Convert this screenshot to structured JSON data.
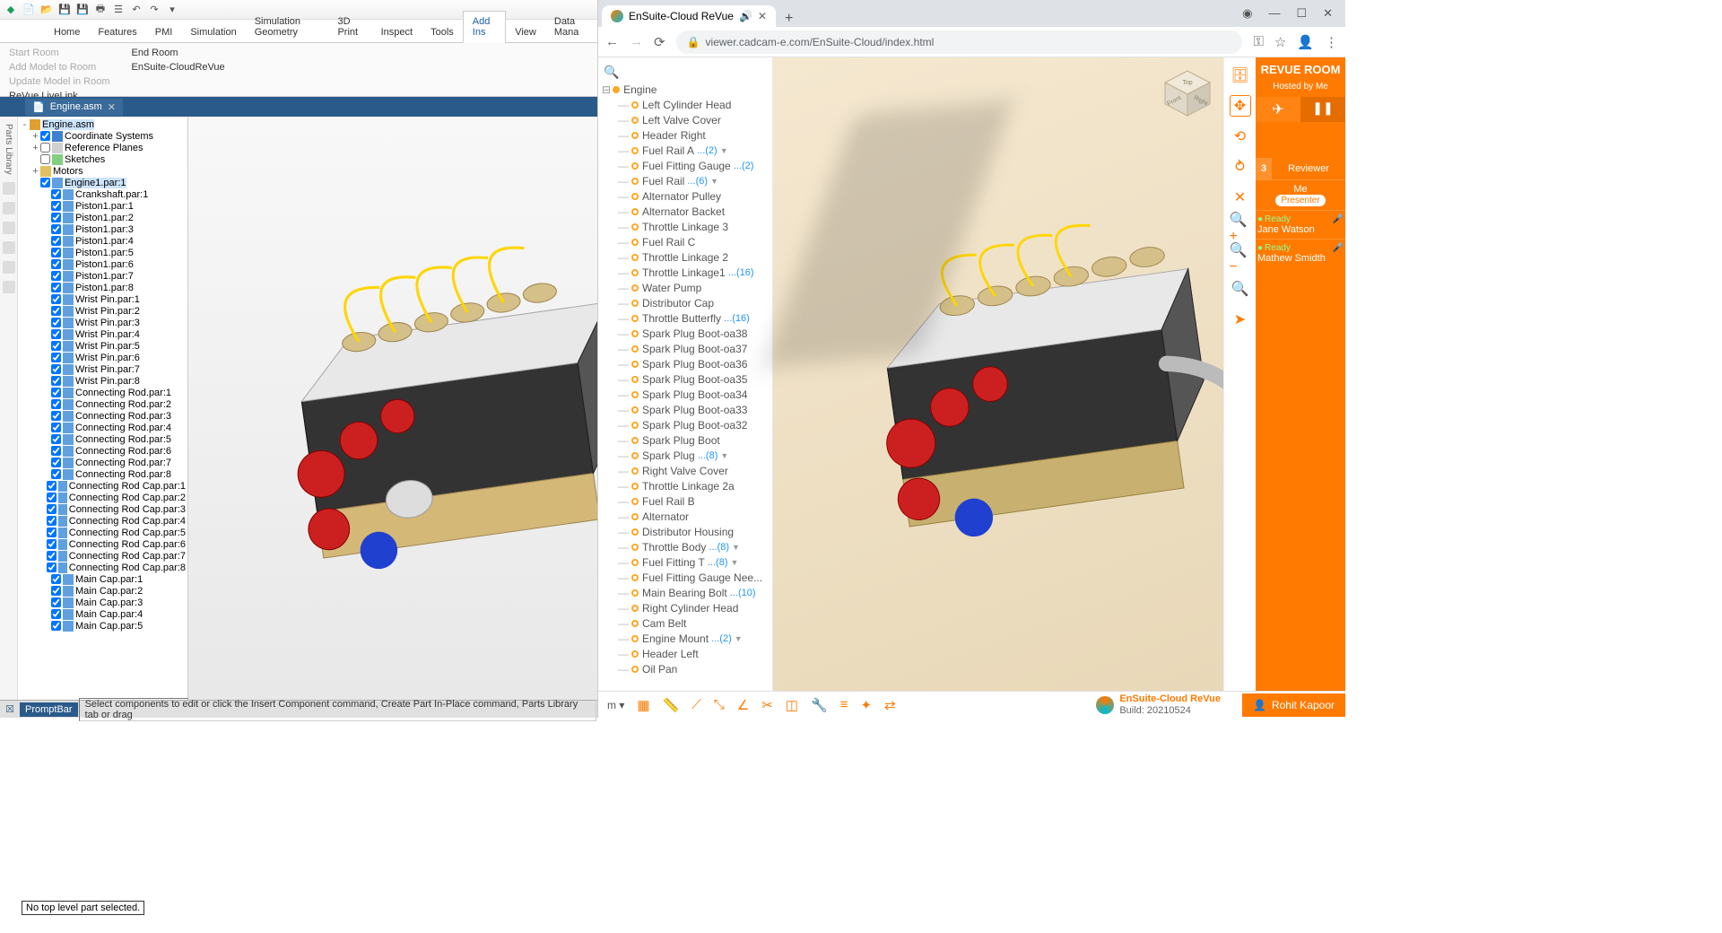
{
  "left": {
    "ribbon_tabs": [
      "Home",
      "Features",
      "PMI",
      "Simulation",
      "Simulation Geometry",
      "3D Print",
      "Inspect",
      "Tools",
      "Add Ins",
      "View",
      "Data Mana"
    ],
    "active_tab": "Add Ins",
    "ribbon_groups": {
      "col1": [
        {
          "label": "Start Room",
          "disabled": true
        },
        {
          "label": "Add Model to Room",
          "disabled": true
        },
        {
          "label": "Update Model in Room",
          "disabled": true
        },
        {
          "label": "ReVue LiveLink",
          "disabled": false
        }
      ],
      "col2": [
        {
          "label": "End Room",
          "disabled": false
        },
        {
          "label": "EnSuite-CloudReVue",
          "disabled": false
        }
      ]
    },
    "doc_tab": "Engine.asm",
    "parts_library_label": "Parts Library",
    "tree": [
      {
        "d": 0,
        "exp": "-",
        "ico": "asm",
        "txt": "Engine.asm",
        "sel": true
      },
      {
        "d": 1,
        "exp": "+",
        "chk": true,
        "ico": "coord",
        "txt": "Coordinate Systems"
      },
      {
        "d": 1,
        "exp": "+",
        "chk": false,
        "ico": "plane",
        "txt": "Reference Planes"
      },
      {
        "d": 1,
        "exp": "",
        "chk": false,
        "ico": "sketch",
        "txt": "Sketches"
      },
      {
        "d": 1,
        "exp": "+",
        "ico": "folder",
        "txt": "Motors"
      },
      {
        "d": 1,
        "exp": "",
        "chk": true,
        "ico": "part",
        "txt": "Engine1.par:1",
        "sel": true
      },
      {
        "d": 2,
        "exp": "",
        "chk": true,
        "ico": "part",
        "txt": "Crankshaft.par:1"
      },
      {
        "d": 2,
        "exp": "",
        "chk": true,
        "ico": "part",
        "txt": "Piston1.par:1"
      },
      {
        "d": 2,
        "exp": "",
        "chk": true,
        "ico": "part",
        "txt": "Piston1.par:2"
      },
      {
        "d": 2,
        "exp": "",
        "chk": true,
        "ico": "part",
        "txt": "Piston1.par:3"
      },
      {
        "d": 2,
        "exp": "",
        "chk": true,
        "ico": "part",
        "txt": "Piston1.par:4"
      },
      {
        "d": 2,
        "exp": "",
        "chk": true,
        "ico": "part",
        "txt": "Piston1.par:5"
      },
      {
        "d": 2,
        "exp": "",
        "chk": true,
        "ico": "part",
        "txt": "Piston1.par:6"
      },
      {
        "d": 2,
        "exp": "",
        "chk": true,
        "ico": "part",
        "txt": "Piston1.par:7"
      },
      {
        "d": 2,
        "exp": "",
        "chk": true,
        "ico": "part",
        "txt": "Piston1.par:8"
      },
      {
        "d": 2,
        "exp": "",
        "chk": true,
        "ico": "part",
        "txt": "Wrist Pin.par:1"
      },
      {
        "d": 2,
        "exp": "",
        "chk": true,
        "ico": "part",
        "txt": "Wrist Pin.par:2"
      },
      {
        "d": 2,
        "exp": "",
        "chk": true,
        "ico": "part",
        "txt": "Wrist Pin.par:3"
      },
      {
        "d": 2,
        "exp": "",
        "chk": true,
        "ico": "part",
        "txt": "Wrist Pin.par:4"
      },
      {
        "d": 2,
        "exp": "",
        "chk": true,
        "ico": "part",
        "txt": "Wrist Pin.par:5"
      },
      {
        "d": 2,
        "exp": "",
        "chk": true,
        "ico": "part",
        "txt": "Wrist Pin.par:6"
      },
      {
        "d": 2,
        "exp": "",
        "chk": true,
        "ico": "part",
        "txt": "Wrist Pin.par:7"
      },
      {
        "d": 2,
        "exp": "",
        "chk": true,
        "ico": "part",
        "txt": "Wrist Pin.par:8"
      },
      {
        "d": 2,
        "exp": "",
        "chk": true,
        "ico": "part",
        "txt": "Connecting Rod.par:1"
      },
      {
        "d": 2,
        "exp": "",
        "chk": true,
        "ico": "part",
        "txt": "Connecting Rod.par:2"
      },
      {
        "d": 2,
        "exp": "",
        "chk": true,
        "ico": "part",
        "txt": "Connecting Rod.par:3"
      },
      {
        "d": 2,
        "exp": "",
        "chk": true,
        "ico": "part",
        "txt": "Connecting Rod.par:4"
      },
      {
        "d": 2,
        "exp": "",
        "chk": true,
        "ico": "part",
        "txt": "Connecting Rod.par:5"
      },
      {
        "d": 2,
        "exp": "",
        "chk": true,
        "ico": "part",
        "txt": "Connecting Rod.par:6"
      },
      {
        "d": 2,
        "exp": "",
        "chk": true,
        "ico": "part",
        "txt": "Connecting Rod.par:7"
      },
      {
        "d": 2,
        "exp": "",
        "chk": true,
        "ico": "part",
        "txt": "Connecting Rod.par:8"
      },
      {
        "d": 2,
        "exp": "",
        "chk": true,
        "ico": "part",
        "txt": "Connecting Rod Cap.par:1"
      },
      {
        "d": 2,
        "exp": "",
        "chk": true,
        "ico": "part",
        "txt": "Connecting Rod Cap.par:2"
      },
      {
        "d": 2,
        "exp": "",
        "chk": true,
        "ico": "part",
        "txt": "Connecting Rod Cap.par:3"
      },
      {
        "d": 2,
        "exp": "",
        "chk": true,
        "ico": "part",
        "txt": "Connecting Rod Cap.par:4"
      },
      {
        "d": 2,
        "exp": "",
        "chk": true,
        "ico": "part",
        "txt": "Connecting Rod Cap.par:5"
      },
      {
        "d": 2,
        "exp": "",
        "chk": true,
        "ico": "part",
        "txt": "Connecting Rod Cap.par:6"
      },
      {
        "d": 2,
        "exp": "",
        "chk": true,
        "ico": "part",
        "txt": "Connecting Rod Cap.par:7"
      },
      {
        "d": 2,
        "exp": "",
        "chk": true,
        "ico": "part",
        "txt": "Connecting Rod Cap.par:8"
      },
      {
        "d": 2,
        "exp": "",
        "chk": true,
        "ico": "part",
        "txt": "Main Cap.par:1"
      },
      {
        "d": 2,
        "exp": "",
        "chk": true,
        "ico": "part",
        "txt": "Main Cap.par:2"
      },
      {
        "d": 2,
        "exp": "",
        "chk": true,
        "ico": "part",
        "txt": "Main Cap.par:3"
      },
      {
        "d": 2,
        "exp": "",
        "chk": true,
        "ico": "part",
        "txt": "Main Cap.par:4"
      },
      {
        "d": 2,
        "exp": "",
        "chk": true,
        "ico": "part",
        "txt": "Main Cap.par:5"
      }
    ],
    "no_top": "No top level part selected.",
    "promptbar_label": "PromptBar",
    "status_msg": "Select components to edit or click the Insert Component command, Create Part In-Place command, Parts Library tab or drag"
  },
  "browser": {
    "tab_title": "EnSuite-Cloud ReVue",
    "url": "viewer.cadcam-e.com/EnSuite-Cloud/index.html",
    "tree_root": "Engine",
    "tree": [
      {
        "txt": "Left Cylinder Head"
      },
      {
        "txt": "Left Valve Cover"
      },
      {
        "txt": "Header Right"
      },
      {
        "txt": "Fuel Rail A",
        "cnt": "...(2)",
        "exp": true
      },
      {
        "txt": "Fuel Fitting Gauge",
        "cnt": "...(2)"
      },
      {
        "txt": "Fuel Rail",
        "cnt": "...(6)",
        "exp": true
      },
      {
        "txt": "Alternator Pulley"
      },
      {
        "txt": "Alternator Backet"
      },
      {
        "txt": "Throttle Linkage 3"
      },
      {
        "txt": "Fuel Rail C"
      },
      {
        "txt": "Throttle Linkage 2"
      },
      {
        "txt": "Throttle Linkage1",
        "cnt": "...(16)"
      },
      {
        "txt": "Water Pump"
      },
      {
        "txt": "Distributor Cap"
      },
      {
        "txt": "Throttle Butterfly",
        "cnt": "...(16)"
      },
      {
        "txt": "Spark Plug Boot-oa38"
      },
      {
        "txt": "Spark Plug Boot-oa37"
      },
      {
        "txt": "Spark Plug Boot-oa36"
      },
      {
        "txt": "Spark Plug Boot-oa35"
      },
      {
        "txt": "Spark Plug Boot-oa34"
      },
      {
        "txt": "Spark Plug Boot-oa33"
      },
      {
        "txt": "Spark Plug Boot-oa32"
      },
      {
        "txt": "Spark Plug Boot"
      },
      {
        "txt": "Spark Plug",
        "cnt": "...(8)",
        "exp": true
      },
      {
        "txt": "Right Valve Cover"
      },
      {
        "txt": "Throttle Linkage 2a"
      },
      {
        "txt": "Fuel Rail B"
      },
      {
        "txt": "Alternator"
      },
      {
        "txt": "Distributor Housing"
      },
      {
        "txt": "Throttle Body",
        "cnt": "...(8)",
        "exp": true
      },
      {
        "txt": "Fuel Fitting T",
        "cnt": "...(8)",
        "exp": true
      },
      {
        "txt": "Fuel Fitting Gauge Nee..."
      },
      {
        "txt": "Main Bearing Bolt",
        "cnt": "...(10)"
      },
      {
        "txt": "Right Cylinder Head"
      },
      {
        "txt": "Cam Belt"
      },
      {
        "txt": "Engine Mount",
        "cnt": "...(2)",
        "exp": true
      },
      {
        "txt": "Header Left"
      },
      {
        "txt": "Oil Pan"
      }
    ],
    "revue": {
      "title": "REVUE ROOM",
      "subtitle": "Hosted by Me",
      "count": "3",
      "role": "Reviewer",
      "me": "Me",
      "presenter": "Presenter",
      "users": [
        {
          "status": "Ready",
          "name": "Jane Watson"
        },
        {
          "status": "Ready",
          "name": "Mathew Smidth"
        }
      ]
    },
    "unit": "m",
    "brand": "EnSuite-Cloud ReVue",
    "build": "Build: 20210524",
    "footer_user": "Rohit Kapoor"
  }
}
